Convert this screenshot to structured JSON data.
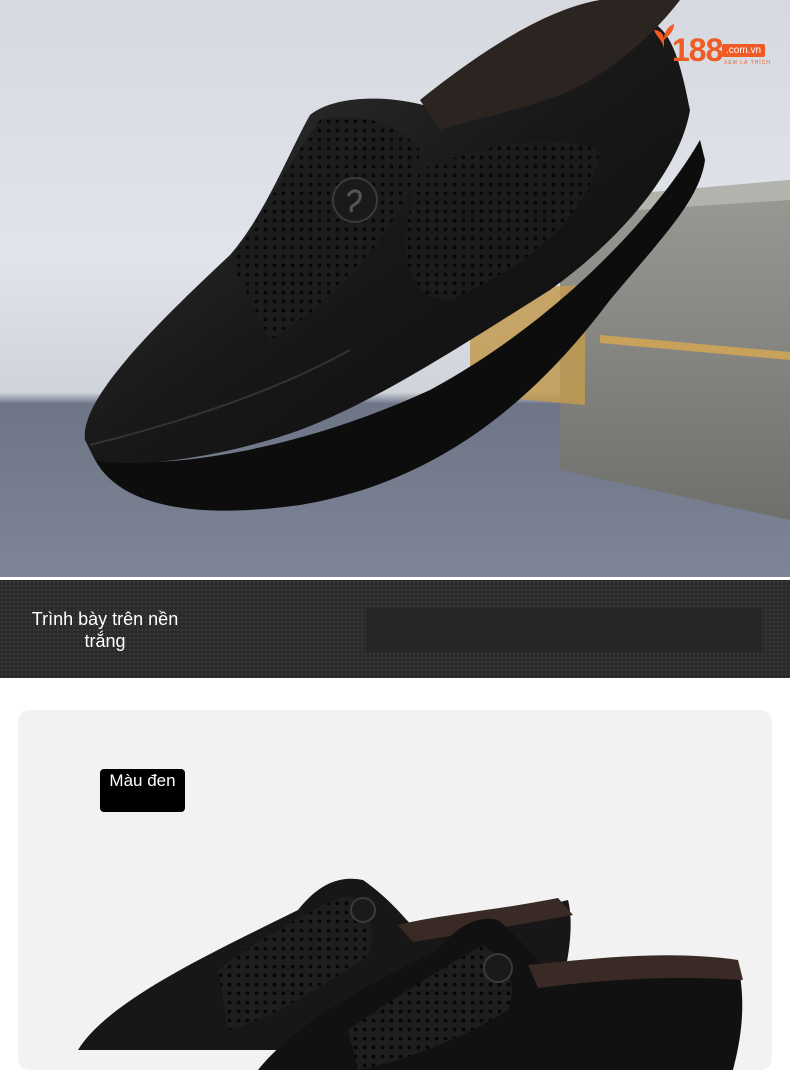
{
  "hero": {
    "image": "black-perforated-leather-loafer-on-box",
    "logo": {
      "number": "188",
      "domain": ".com.vn",
      "tagline": "XEM LÀ THÍCH",
      "icon": "leaf-icon",
      "color": "#f05a24"
    }
  },
  "band": {
    "label": "Trình bày trên nền trắng"
  },
  "card": {
    "badge": "Màu đen",
    "image": "pair-of-black-perforated-loafers"
  }
}
